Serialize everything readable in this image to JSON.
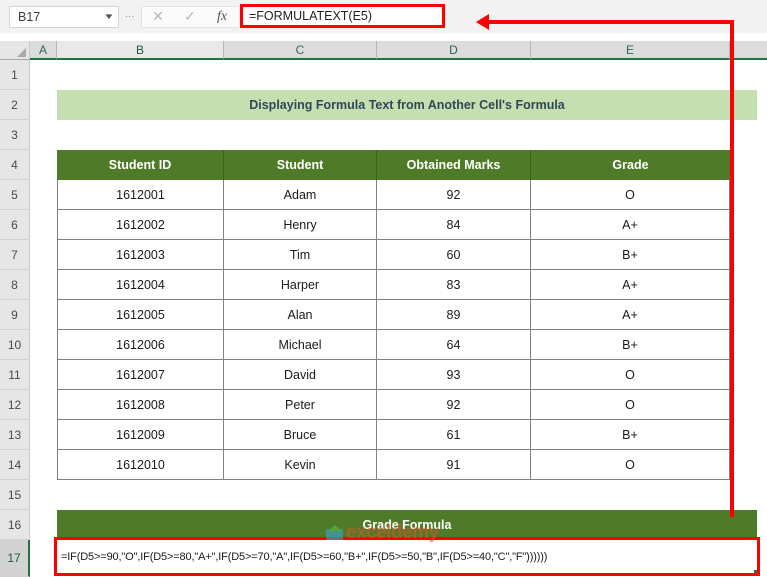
{
  "formula_bar": {
    "name_box_value": "B17",
    "cancel_icon": "close-icon",
    "enter_icon": "check-icon",
    "function_icon": "fx-icon",
    "formula_value": "=FORMULATEXT(E5)"
  },
  "sheet": {
    "column_headers": [
      "A",
      "B",
      "C",
      "D",
      "E"
    ],
    "row_headers": [
      "1",
      "2",
      "3",
      "4",
      "5",
      "6",
      "7",
      "8",
      "9",
      "10",
      "11",
      "12",
      "13",
      "14",
      "15",
      "16",
      "17"
    ],
    "active_row": "17",
    "active_column": "B"
  },
  "banner": {
    "title": "Displaying Formula Text from Another Cell's Formula"
  },
  "table": {
    "headers": [
      "Student ID",
      "Student",
      "Obtained Marks",
      "Grade"
    ],
    "rows": [
      [
        "1612001",
        "Adam",
        "92",
        "O"
      ],
      [
        "1612002",
        "Henry",
        "84",
        "A+"
      ],
      [
        "1612003",
        "Tim",
        "60",
        "B+"
      ],
      [
        "1612004",
        "Harper",
        "83",
        "A+"
      ],
      [
        "1612005",
        "Alan",
        "89",
        "A+"
      ],
      [
        "1612006",
        "Michael",
        "64",
        "B+"
      ],
      [
        "1612007",
        "David",
        "93",
        "O"
      ],
      [
        "1612008",
        "Peter",
        "92",
        "O"
      ],
      [
        "1612009",
        "Bruce",
        "61",
        "B+"
      ],
      [
        "1612010",
        "Kevin",
        "91",
        "O"
      ]
    ]
  },
  "grade_formula": {
    "header": "Grade Formula",
    "value": "=IF(D5>=90,\"O\",IF(D5>=80,\"A+\",IF(D5>=70,\"A\",IF(D5>=60,\"B+\",IF(D5>=50,\"B\",IF(D5>=40,\"C\",\"F\"))))))"
  },
  "watermark": {
    "text": "exceldemy"
  },
  "colors": {
    "header_green": "#4f7b29",
    "banner_green": "#c6dfb0",
    "annotation_red": "#ff0000",
    "sheet_tab_green": "#217346"
  }
}
